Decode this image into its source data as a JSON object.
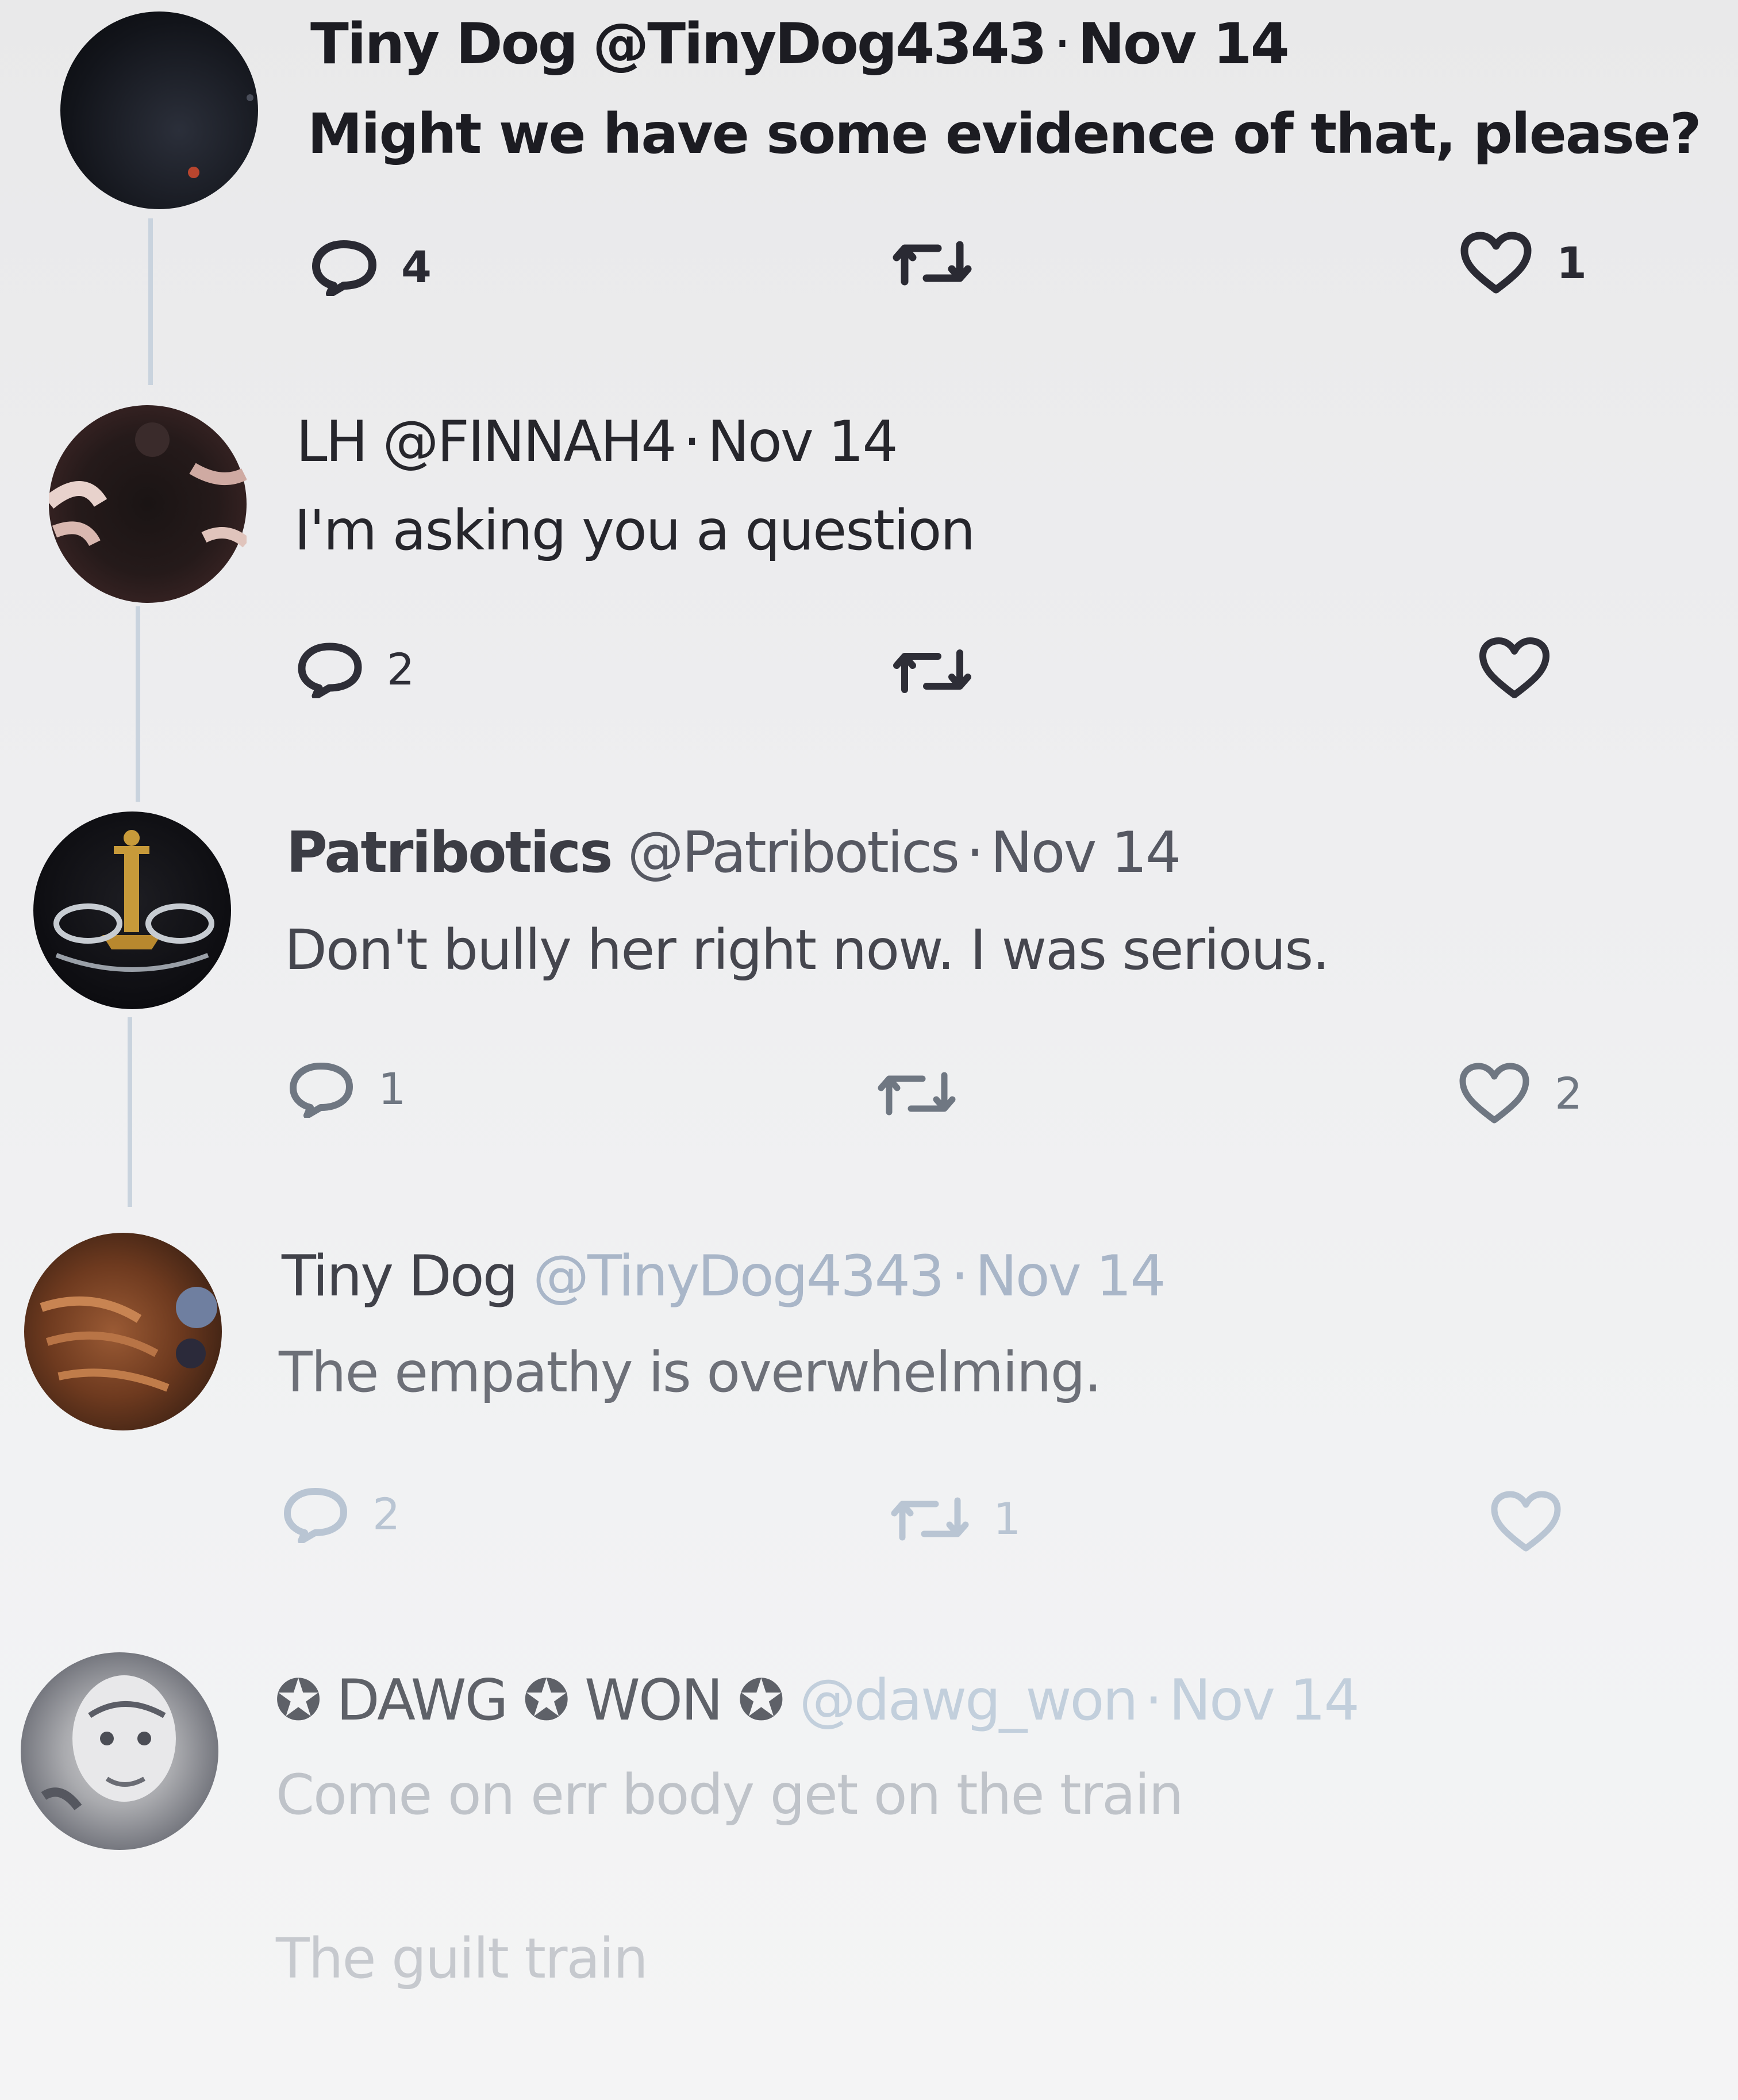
{
  "colors": {
    "background": "#eeeef0",
    "thread_line": "#c9d3de",
    "icon_dark": "#2a2a33",
    "icon_faded": "#b9c5d3"
  },
  "tweets": [
    {
      "name": "Tiny Dog",
      "handle": "@TinyDog4343",
      "separator": "·",
      "date": "Nov 14",
      "text": "Might we have some evidence of that, please?",
      "replies": "4",
      "retweets": "",
      "likes": "1"
    },
    {
      "name": "LH",
      "handle": "@FINNAH4",
      "separator": "·",
      "date": "Nov 14",
      "text": "I'm asking you a question",
      "replies": "2",
      "retweets": "",
      "likes": ""
    },
    {
      "name": "Patribotics",
      "handle": "@Patribotics",
      "separator": "·",
      "date": "Nov 14",
      "text": "Don't bully her right now. I was serious.",
      "replies": "1",
      "retweets": "",
      "likes": "2"
    },
    {
      "name": "Tiny Dog",
      "handle": "@TinyDog4343",
      "separator": "·",
      "date": "Nov 14",
      "text": "The empathy is overwhelming.",
      "replies": "2",
      "retweets": "1",
      "likes": ""
    },
    {
      "name": "✪ DAWG ✪ WON ✪",
      "handle": "@dawg_won",
      "separator": "·",
      "date": "Nov 14",
      "text": "Come on err body get on the train",
      "extra_text": "The guilt train"
    }
  ],
  "icons": {
    "reply": "reply-bubble-icon",
    "retweet": "retweet-arrows-icon",
    "like": "heart-icon"
  }
}
